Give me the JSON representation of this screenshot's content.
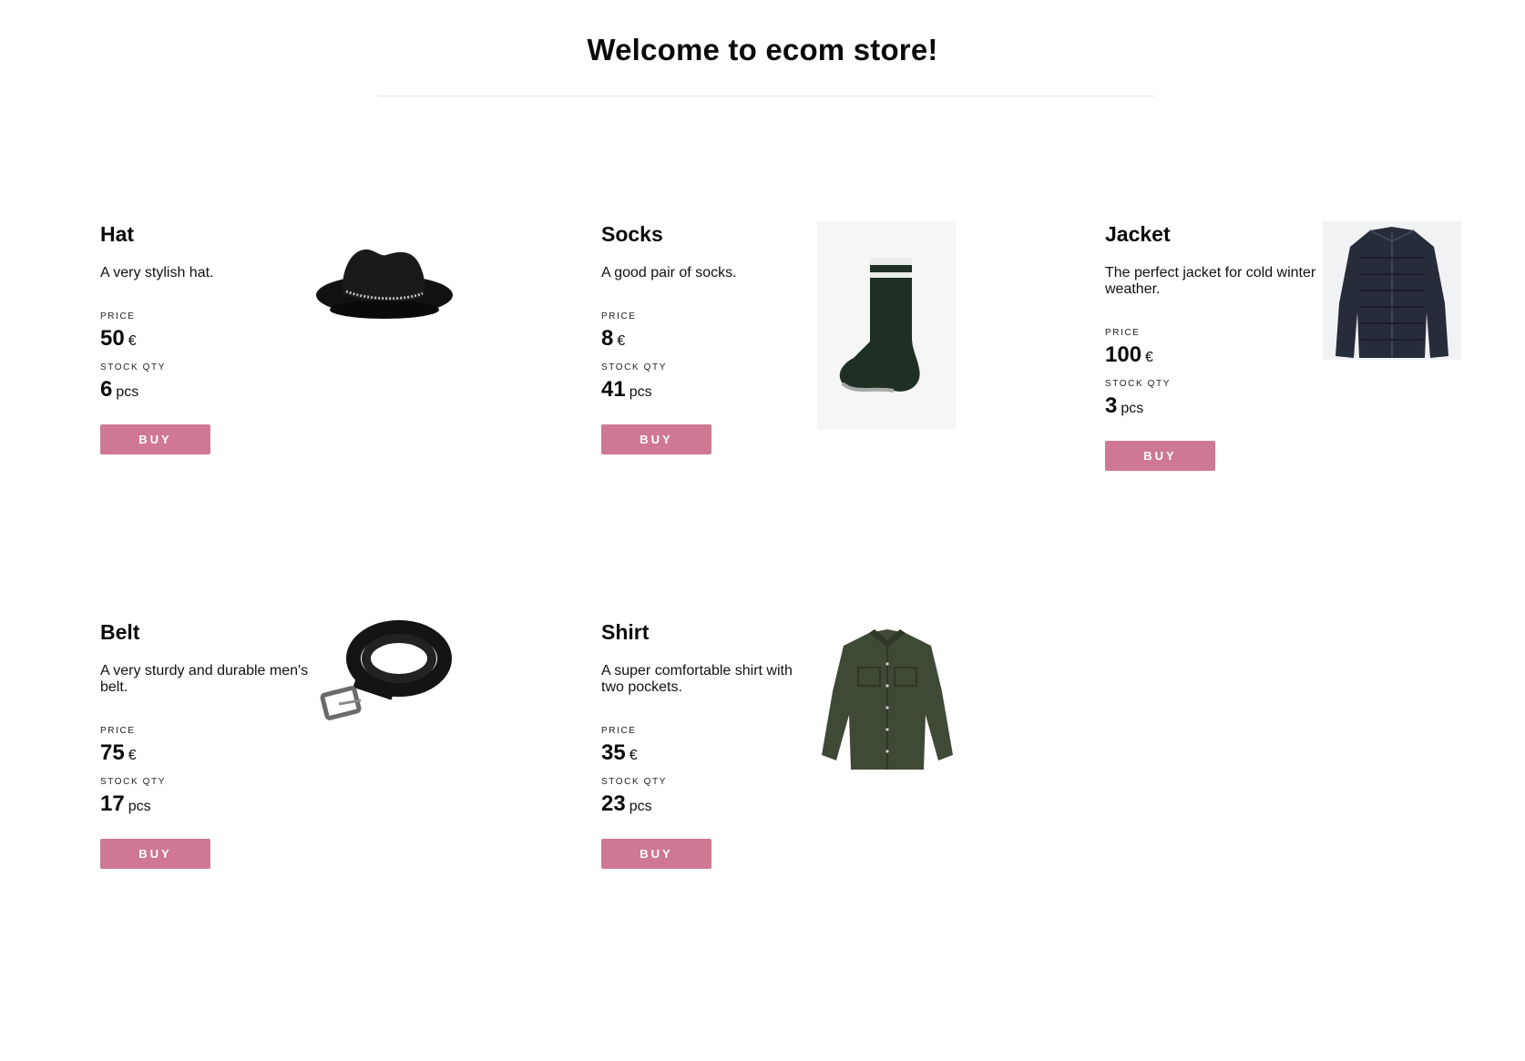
{
  "header": {
    "title": "Welcome to ecom store!"
  },
  "labels": {
    "price": "PRICE",
    "stock": "STOCK QTY",
    "currency": "€",
    "unit": "pcs",
    "buy": "BUY"
  },
  "products": [
    {
      "name": "Hat",
      "description": "A very stylish hat.",
      "price": "50",
      "stock": "6",
      "image": "hat-image"
    },
    {
      "name": "Socks",
      "description": "A good pair of socks.",
      "price": "8",
      "stock": "41",
      "image": "socks-image"
    },
    {
      "name": "Jacket",
      "description": "The perfect jacket for cold winter weather.",
      "price": "100",
      "stock": "3",
      "image": "jacket-image"
    },
    {
      "name": "Belt",
      "description": "A very sturdy and durable men's belt.",
      "price": "75",
      "stock": "17",
      "image": "belt-image"
    },
    {
      "name": "Shirt",
      "description": "A super comfortable shirt with two pockets.",
      "price": "35",
      "stock": "23",
      "image": "shirt-image"
    }
  ],
  "colors": {
    "buy_button": "#cf7893",
    "divider": "#e3e3e3"
  }
}
